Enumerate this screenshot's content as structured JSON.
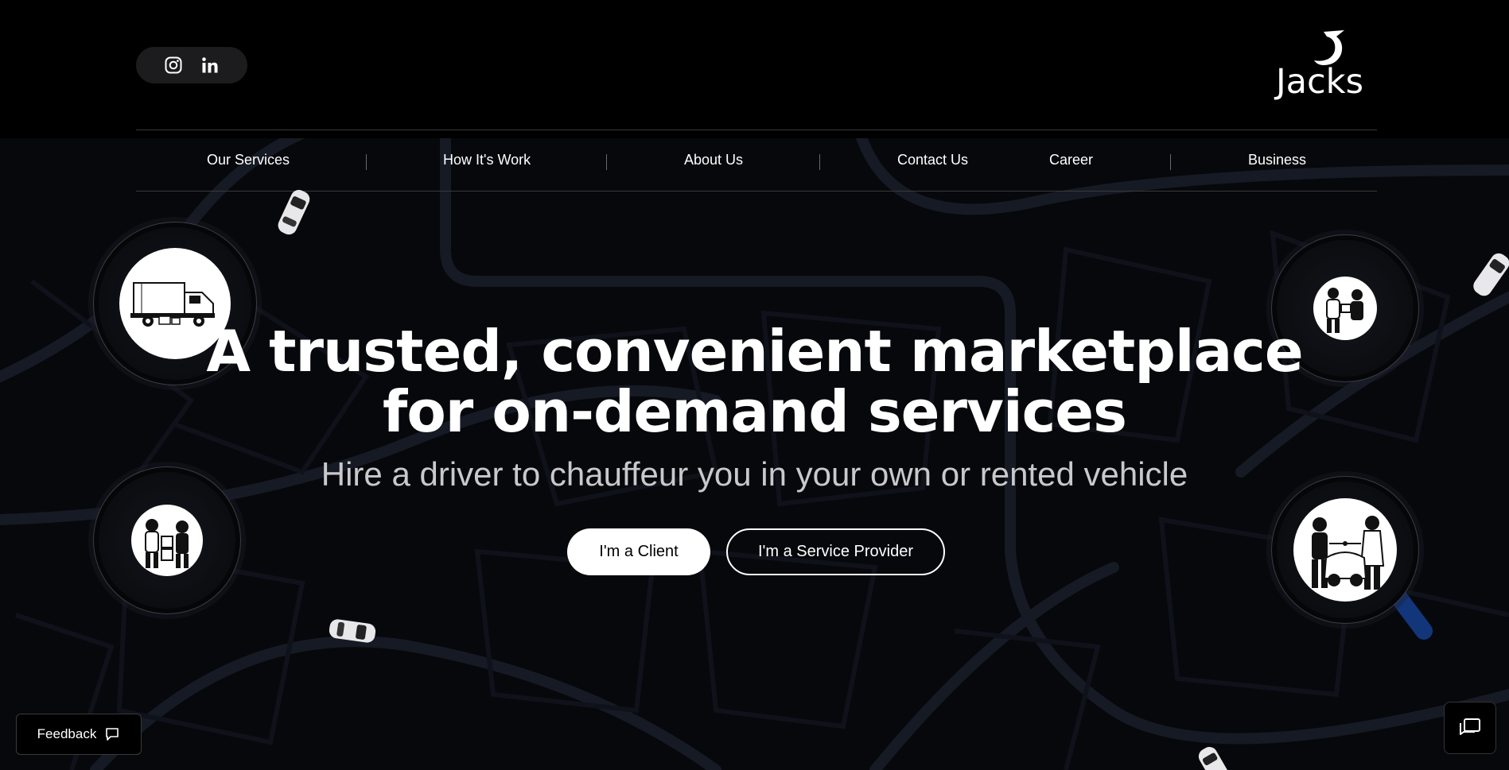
{
  "social": {
    "icons": [
      "instagram-icon",
      "linkedin-icon"
    ]
  },
  "logo": {
    "text": "Jacks"
  },
  "nav": {
    "items": [
      "Our Services",
      "How It's Work",
      "About Us",
      "Contact Us",
      "Career",
      "Business"
    ]
  },
  "hero": {
    "title_line1": "A trusted, convenient marketplace",
    "title_line2": "for on-demand services",
    "subtitle": "Hire a driver to chauffeur you in your own or rented vehicle"
  },
  "buttons": {
    "client": "I'm a Client",
    "provider": "I'm a Service Provider"
  },
  "feedback": {
    "label": "Feedback"
  },
  "colors": {
    "background": "#000000",
    "map": "#07080c",
    "accent_blue": "#1e5bd6",
    "text_muted": "#c9c9cc"
  }
}
